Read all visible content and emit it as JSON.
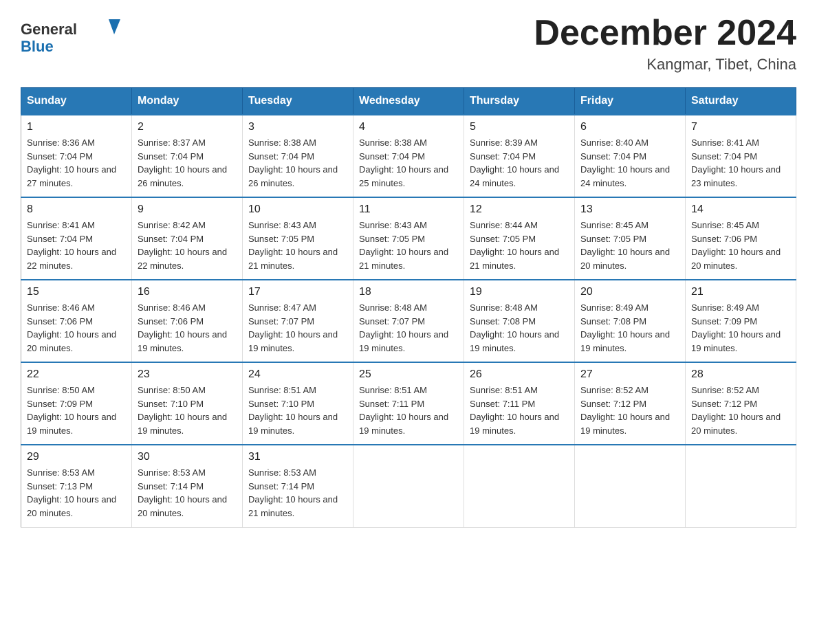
{
  "header": {
    "logo_line1": "General",
    "logo_line2": "Blue",
    "month_title": "December 2024",
    "location": "Kangmar, Tibet, China"
  },
  "days_of_week": [
    "Sunday",
    "Monday",
    "Tuesday",
    "Wednesday",
    "Thursday",
    "Friday",
    "Saturday"
  ],
  "weeks": [
    [
      {
        "day": "1",
        "sunrise": "8:36 AM",
        "sunset": "7:04 PM",
        "daylight": "10 hours and 27 minutes."
      },
      {
        "day": "2",
        "sunrise": "8:37 AM",
        "sunset": "7:04 PM",
        "daylight": "10 hours and 26 minutes."
      },
      {
        "day": "3",
        "sunrise": "8:38 AM",
        "sunset": "7:04 PM",
        "daylight": "10 hours and 26 minutes."
      },
      {
        "day": "4",
        "sunrise": "8:38 AM",
        "sunset": "7:04 PM",
        "daylight": "10 hours and 25 minutes."
      },
      {
        "day": "5",
        "sunrise": "8:39 AM",
        "sunset": "7:04 PM",
        "daylight": "10 hours and 24 minutes."
      },
      {
        "day": "6",
        "sunrise": "8:40 AM",
        "sunset": "7:04 PM",
        "daylight": "10 hours and 24 minutes."
      },
      {
        "day": "7",
        "sunrise": "8:41 AM",
        "sunset": "7:04 PM",
        "daylight": "10 hours and 23 minutes."
      }
    ],
    [
      {
        "day": "8",
        "sunrise": "8:41 AM",
        "sunset": "7:04 PM",
        "daylight": "10 hours and 22 minutes."
      },
      {
        "day": "9",
        "sunrise": "8:42 AM",
        "sunset": "7:04 PM",
        "daylight": "10 hours and 22 minutes."
      },
      {
        "day": "10",
        "sunrise": "8:43 AM",
        "sunset": "7:05 PM",
        "daylight": "10 hours and 21 minutes."
      },
      {
        "day": "11",
        "sunrise": "8:43 AM",
        "sunset": "7:05 PM",
        "daylight": "10 hours and 21 minutes."
      },
      {
        "day": "12",
        "sunrise": "8:44 AM",
        "sunset": "7:05 PM",
        "daylight": "10 hours and 21 minutes."
      },
      {
        "day": "13",
        "sunrise": "8:45 AM",
        "sunset": "7:05 PM",
        "daylight": "10 hours and 20 minutes."
      },
      {
        "day": "14",
        "sunrise": "8:45 AM",
        "sunset": "7:06 PM",
        "daylight": "10 hours and 20 minutes."
      }
    ],
    [
      {
        "day": "15",
        "sunrise": "8:46 AM",
        "sunset": "7:06 PM",
        "daylight": "10 hours and 20 minutes."
      },
      {
        "day": "16",
        "sunrise": "8:46 AM",
        "sunset": "7:06 PM",
        "daylight": "10 hours and 19 minutes."
      },
      {
        "day": "17",
        "sunrise": "8:47 AM",
        "sunset": "7:07 PM",
        "daylight": "10 hours and 19 minutes."
      },
      {
        "day": "18",
        "sunrise": "8:48 AM",
        "sunset": "7:07 PM",
        "daylight": "10 hours and 19 minutes."
      },
      {
        "day": "19",
        "sunrise": "8:48 AM",
        "sunset": "7:08 PM",
        "daylight": "10 hours and 19 minutes."
      },
      {
        "day": "20",
        "sunrise": "8:49 AM",
        "sunset": "7:08 PM",
        "daylight": "10 hours and 19 minutes."
      },
      {
        "day": "21",
        "sunrise": "8:49 AM",
        "sunset": "7:09 PM",
        "daylight": "10 hours and 19 minutes."
      }
    ],
    [
      {
        "day": "22",
        "sunrise": "8:50 AM",
        "sunset": "7:09 PM",
        "daylight": "10 hours and 19 minutes."
      },
      {
        "day": "23",
        "sunrise": "8:50 AM",
        "sunset": "7:10 PM",
        "daylight": "10 hours and 19 minutes."
      },
      {
        "day": "24",
        "sunrise": "8:51 AM",
        "sunset": "7:10 PM",
        "daylight": "10 hours and 19 minutes."
      },
      {
        "day": "25",
        "sunrise": "8:51 AM",
        "sunset": "7:11 PM",
        "daylight": "10 hours and 19 minutes."
      },
      {
        "day": "26",
        "sunrise": "8:51 AM",
        "sunset": "7:11 PM",
        "daylight": "10 hours and 19 minutes."
      },
      {
        "day": "27",
        "sunrise": "8:52 AM",
        "sunset": "7:12 PM",
        "daylight": "10 hours and 19 minutes."
      },
      {
        "day": "28",
        "sunrise": "8:52 AM",
        "sunset": "7:12 PM",
        "daylight": "10 hours and 20 minutes."
      }
    ],
    [
      {
        "day": "29",
        "sunrise": "8:53 AM",
        "sunset": "7:13 PM",
        "daylight": "10 hours and 20 minutes."
      },
      {
        "day": "30",
        "sunrise": "8:53 AM",
        "sunset": "7:14 PM",
        "daylight": "10 hours and 20 minutes."
      },
      {
        "day": "31",
        "sunrise": "8:53 AM",
        "sunset": "7:14 PM",
        "daylight": "10 hours and 21 minutes."
      },
      null,
      null,
      null,
      null
    ]
  ]
}
